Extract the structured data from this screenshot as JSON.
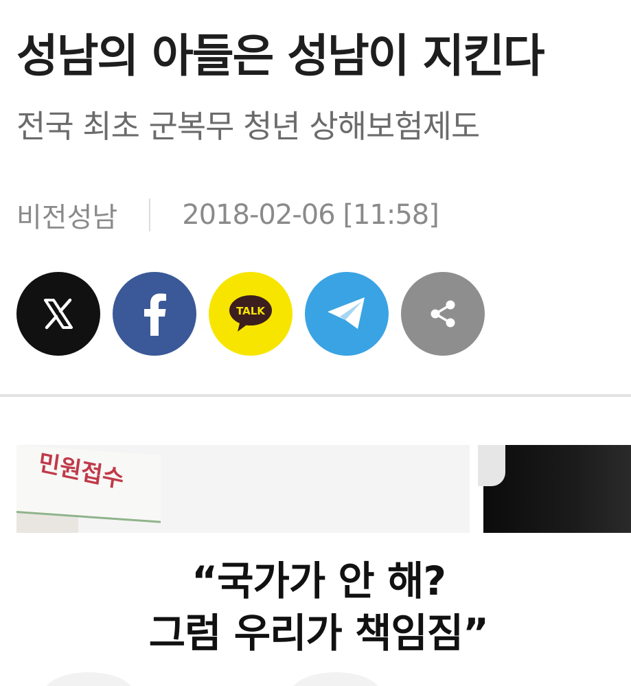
{
  "article": {
    "headline": "성남의 아들은 성남이 지킨다",
    "subheadline": "전국 최초 군복무 청년 상해보험제도",
    "author": "비전성남",
    "timestamp": "2018-02-06 [11:58]"
  },
  "share": {
    "buttons": [
      {
        "id": "x",
        "icon": "x-logo-icon",
        "color": "#111111"
      },
      {
        "id": "facebook",
        "icon": "facebook-icon",
        "color": "#3b5998"
      },
      {
        "id": "kakaotalk",
        "icon": "kakaotalk-icon",
        "label": "TALK",
        "color": "#f7e500"
      },
      {
        "id": "telegram",
        "icon": "telegram-icon",
        "color": "#3aa3e3"
      },
      {
        "id": "more",
        "icon": "share-icon",
        "color": "#8e8e8e"
      }
    ]
  },
  "image": {
    "banner_text": "민원접수",
    "caption_line1": "“국가가 안 해?",
    "caption_line2": "그럼 우리가 책임짐”"
  }
}
